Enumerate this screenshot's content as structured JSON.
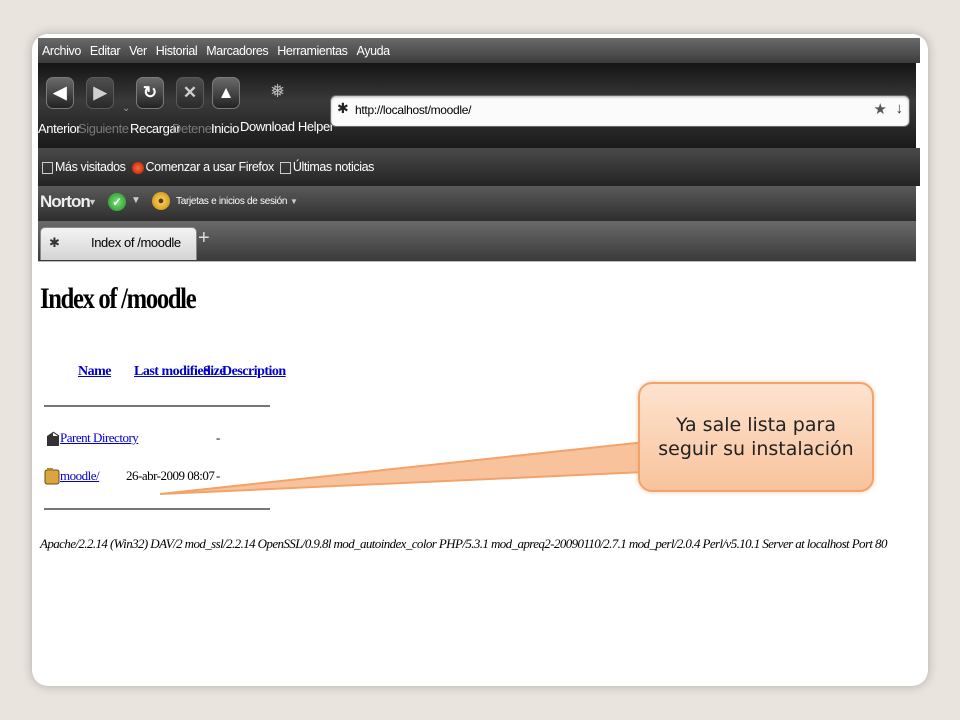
{
  "menubar": {
    "items": [
      "Archivo",
      "Editar",
      "Ver",
      "Historial",
      "Marcadores",
      "Herramientas",
      "Ayuda"
    ]
  },
  "navbar": {
    "back_label": "Anterior",
    "forward_label": "Siguiente",
    "reload_label": "Recargar",
    "stop_label": "Detener",
    "home_label": "Inicio",
    "download_helper_label": "Download Helper"
  },
  "urlbar": {
    "url": "http://localhost/moodle/"
  },
  "bookmarks": {
    "items": [
      "Más visitados",
      "Comenzar a usar Firefox",
      "Últimas noticias"
    ]
  },
  "norton": {
    "logo": "Norton",
    "cards_label": "Tarjetas e inicios de sesión"
  },
  "tab": {
    "title": "Index of /moodle"
  },
  "page": {
    "heading": "Index of /moodle",
    "columns": {
      "name": "Name",
      "last_modified": "Last modified",
      "size": "Size",
      "description": "Description"
    },
    "rows": [
      {
        "name": "Parent Directory",
        "date": "",
        "size": "-",
        "icon": "back-folder-icon"
      },
      {
        "name": "moodle/",
        "date": "26-abr-2009 08:07",
        "size": "-",
        "icon": "folder-icon"
      }
    ],
    "server_signature": "Apache/2.2.14 (Win32) DAV/2 mod_ssl/2.2.14 OpenSSL/0.9.8l mod_autoindex_color PHP/5.3.1 mod_apreq2-20090110/2.7.1 mod_perl/2.0.4 Perl/v5.10.1 Server at localhost Port 80"
  },
  "callout": {
    "text": "Ya sale lista para seguir su instalación"
  }
}
